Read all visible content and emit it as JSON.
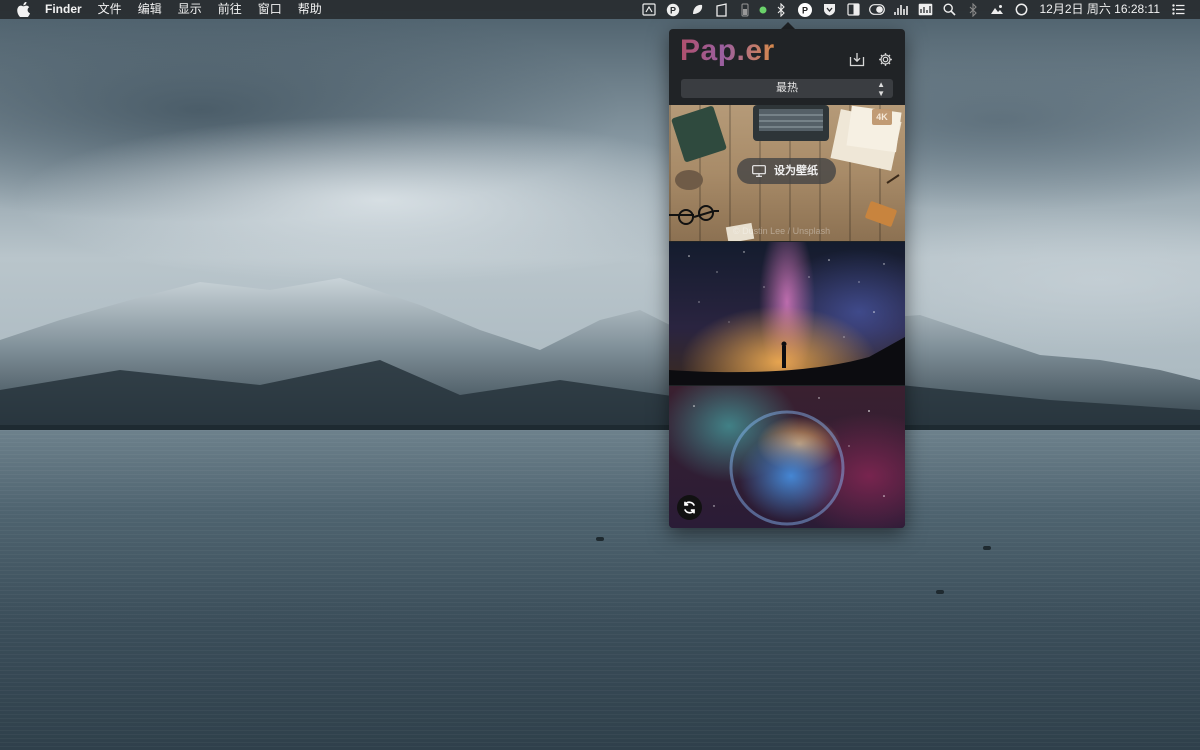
{
  "menubar": {
    "app_name": "Finder",
    "menus": [
      "文件",
      "编辑",
      "显示",
      "前往",
      "窗口",
      "帮助"
    ],
    "clock": "12月2日 周六  16:28:11",
    "tray_icons": [
      "screenshot-icon",
      "pocket-p-icon",
      "leaf-icon",
      "clipboard-icon",
      "battery-small-icon",
      "status-dot-icon",
      "bluetooth-icon",
      "paper-app-icon",
      "shield-icon",
      "columns-icon",
      "toggle-icon",
      "activity-icon",
      "istat-icon",
      "spotlight-search-icon",
      "bluetooth-icon",
      "photo-icon",
      "siri-icon",
      "notification-center-icon"
    ],
    "colors": {
      "status_dot": "#6bd36b"
    }
  },
  "popover": {
    "logo": "Pap.er",
    "sort_select": {
      "value": "最热"
    },
    "wallpapers": [
      {
        "badge": "4K",
        "set_button_label": "设为壁纸",
        "credit": "© Dustin Lee / Unsplash"
      },
      {},
      {}
    ],
    "colors": {
      "background": "#202326",
      "logo_start": "#b0506c",
      "logo_end": "#d88a4a",
      "badge": "#be966e"
    }
  }
}
